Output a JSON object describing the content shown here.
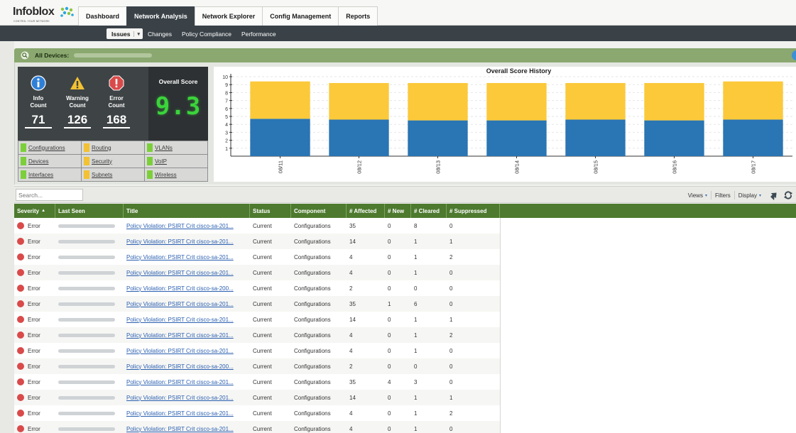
{
  "brand": {
    "name": "Infoblox",
    "tagline": "CONTROL YOUR NETWORK"
  },
  "main_tabs": [
    {
      "label": "Dashboard",
      "active": false
    },
    {
      "label": "Network Analysis",
      "active": true
    },
    {
      "label": "Network Explorer",
      "active": false
    },
    {
      "label": "Config Management",
      "active": false
    },
    {
      "label": "Reports",
      "active": false
    }
  ],
  "sub_tabs": [
    {
      "label": "Issues",
      "active": true,
      "caret": "▾"
    },
    {
      "label": "Changes",
      "active": false
    },
    {
      "label": "Policy Compliance",
      "active": false
    },
    {
      "label": "Performance",
      "active": false
    }
  ],
  "devices_bar": {
    "label": "All Devices:"
  },
  "counts": {
    "info": {
      "label_line1": "Info",
      "label_line2": "Count",
      "value": "71"
    },
    "warning": {
      "label_line1": "Warning",
      "label_line2": "Count",
      "value": "126"
    },
    "error": {
      "label_line1": "Error",
      "label_line2": "Count",
      "value": "168"
    },
    "overall": {
      "label": "Overall Score",
      "value": "9.3"
    }
  },
  "components": [
    {
      "name": "Configurations",
      "status_color": "#7ccf3a"
    },
    {
      "name": "Routing",
      "status_color": "#f3c132"
    },
    {
      "name": "VLANs",
      "status_color": "#7ccf3a"
    },
    {
      "name": "Devices",
      "status_color": "#7ccf3a"
    },
    {
      "name": "Security",
      "status_color": "#f3c132"
    },
    {
      "name": "VoIP",
      "status_color": "#7ccf3a"
    },
    {
      "name": "Interfaces",
      "status_color": "#7ccf3a"
    },
    {
      "name": "Subnets",
      "status_color": "#f3c132"
    },
    {
      "name": "Wireless",
      "status_color": "#7ccf3a"
    }
  ],
  "chart_data": {
    "type": "bar",
    "stacked": true,
    "title": "Overall Score History",
    "categories": [
      "08/11",
      "08/12",
      "08/13",
      "08/14",
      "08/15",
      "08/16",
      "08/17"
    ],
    "series": [
      {
        "color": "#2a75b3",
        "values": [
          4.7,
          4.6,
          4.5,
          4.5,
          4.6,
          4.5,
          4.6
        ]
      },
      {
        "color": "#fbc93a",
        "values": [
          4.7,
          4.6,
          4.7,
          4.7,
          4.6,
          4.7,
          4.8
        ]
      }
    ],
    "ylim": [
      0,
      10
    ],
    "yticks": [
      1,
      2,
      3,
      4,
      5,
      6,
      7,
      8,
      9,
      10
    ],
    "grid": "horizontal dashed"
  },
  "toolbar": {
    "search_placeholder": "Search...",
    "views_label": "Views",
    "filters_label": "Filters",
    "display_label": "Display",
    "menu_caret": "▾"
  },
  "table": {
    "columns": [
      {
        "label": "Severity",
        "sort": "▲"
      },
      {
        "label": "Last Seen"
      },
      {
        "label": "Title"
      },
      {
        "label": "Status"
      },
      {
        "label": "Component"
      },
      {
        "label": "# Affected"
      },
      {
        "label": "# New"
      },
      {
        "label": "# Cleared"
      },
      {
        "label": "# Suppressed"
      }
    ],
    "rows": [
      {
        "severity": "Error",
        "title": "Policy Violation: PSIRT Crit cisco-sa-201...",
        "status": "Current",
        "component": "Configurations",
        "affected": "35",
        "new": "0",
        "cleared": "8",
        "suppressed": "0"
      },
      {
        "severity": "Error",
        "title": "Policy Violation: PSIRT Crit cisco-sa-201...",
        "status": "Current",
        "component": "Configurations",
        "affected": "14",
        "new": "0",
        "cleared": "1",
        "suppressed": "1"
      },
      {
        "severity": "Error",
        "title": "Policy Violation: PSIRT Crit cisco-sa-201...",
        "status": "Current",
        "component": "Configurations",
        "affected": "4",
        "new": "0",
        "cleared": "1",
        "suppressed": "2"
      },
      {
        "severity": "Error",
        "title": "Policy Violation: PSIRT Crit cisco-sa-201...",
        "status": "Current",
        "component": "Configurations",
        "affected": "4",
        "new": "0",
        "cleared": "1",
        "suppressed": "0"
      },
      {
        "severity": "Error",
        "title": "Policy Violation: PSIRT Crit cisco-sa-200...",
        "status": "Current",
        "component": "Configurations",
        "affected": "2",
        "new": "0",
        "cleared": "0",
        "suppressed": "0"
      },
      {
        "severity": "Error",
        "title": "Policy Violation: PSIRT Crit cisco-sa-201...",
        "status": "Current",
        "component": "Configurations",
        "affected": "35",
        "new": "1",
        "cleared": "6",
        "suppressed": "0"
      },
      {
        "severity": "Error",
        "title": "Policy Violation: PSIRT Crit cisco-sa-201...",
        "status": "Current",
        "component": "Configurations",
        "affected": "14",
        "new": "0",
        "cleared": "1",
        "suppressed": "1"
      },
      {
        "severity": "Error",
        "title": "Policy Violation: PSIRT Crit cisco-sa-201...",
        "status": "Current",
        "component": "Configurations",
        "affected": "4",
        "new": "0",
        "cleared": "1",
        "suppressed": "2"
      },
      {
        "severity": "Error",
        "title": "Policy Violation: PSIRT Crit cisco-sa-201...",
        "status": "Current",
        "component": "Configurations",
        "affected": "4",
        "new": "0",
        "cleared": "1",
        "suppressed": "0"
      },
      {
        "severity": "Error",
        "title": "Policy Violation: PSIRT Crit cisco-sa-200...",
        "status": "Current",
        "component": "Configurations",
        "affected": "2",
        "new": "0",
        "cleared": "0",
        "suppressed": "0"
      },
      {
        "severity": "Error",
        "title": "Policy Violation: PSIRT Crit cisco-sa-201...",
        "status": "Current",
        "component": "Configurations",
        "affected": "35",
        "new": "4",
        "cleared": "3",
        "suppressed": "0"
      },
      {
        "severity": "Error",
        "title": "Policy Violation: PSIRT Crit cisco-sa-201...",
        "status": "Current",
        "component": "Configurations",
        "affected": "14",
        "new": "0",
        "cleared": "1",
        "suppressed": "1"
      },
      {
        "severity": "Error",
        "title": "Policy Violation: PSIRT Crit cisco-sa-201...",
        "status": "Current",
        "component": "Configurations",
        "affected": "4",
        "new": "0",
        "cleared": "1",
        "suppressed": "2"
      },
      {
        "severity": "Error",
        "title": "Policy Violation: PSIRT Crit cisco-sa-201...",
        "status": "Current",
        "component": "Configurations",
        "affected": "4",
        "new": "0",
        "cleared": "1",
        "suppressed": "0"
      }
    ]
  },
  "colors": {
    "nav_dark": "#3a4248",
    "accent_green": "#4d7a2e",
    "devices_bar_green": "#8aa86f",
    "error_red": "#d94a4a",
    "info_blue": "#2f7fd6",
    "warning_yellow": "#f3c132",
    "score_green": "#3bd43b",
    "link_blue": "#2a5fb0"
  },
  "icons": {
    "info": "info-circle-icon",
    "warning": "warning-triangle-icon",
    "error": "error-octagon-icon",
    "search": "search-icon",
    "help": "help-icon",
    "export": "export-icon",
    "refresh": "refresh-icon",
    "severity_error": "error-dot-icon"
  }
}
